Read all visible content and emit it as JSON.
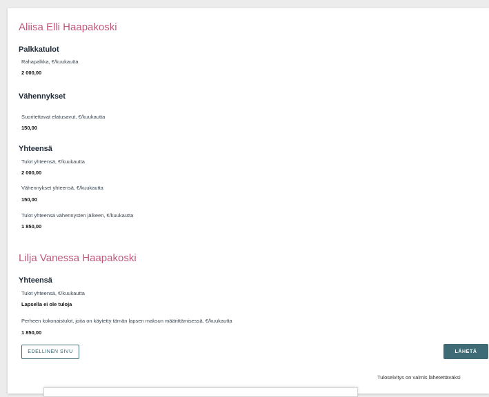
{
  "persons": [
    {
      "name": "Aliisa Elli Haapakoski",
      "salary": {
        "heading": "Palkkatulot",
        "label": "Rahapalkka, €/kuukautta",
        "value": "2 000,00"
      },
      "deductions": {
        "heading": "Vähennykset",
        "label": "Suoritettavat elatusavut, €/kuukautta",
        "value": "150,00"
      },
      "total": {
        "heading": "Yhteensä",
        "items": [
          {
            "label": "Tulot yhteensä, €/kuukautta",
            "value": "2 000,00"
          },
          {
            "label": "Vähennykset yhteensä, €/kuukautta",
            "value": "150,00"
          },
          {
            "label": "Tulot yhteensä vähennysten jälkeen, €/kuukautta",
            "value": "1 850,00"
          }
        ]
      }
    },
    {
      "name": "Lilja Vanessa Haapakoski",
      "total": {
        "heading": "Yhteensä",
        "items": [
          {
            "label": "Tulot yhteensä, €/kuukautta",
            "value": "Lapsella ei ole tuloja"
          },
          {
            "label": "Perheen kokonaistulot, joita on käytetty tämän lapsen maksun määrittämisessä, €/kuukautta",
            "value": "1 850,00"
          }
        ]
      }
    }
  ],
  "buttons": {
    "previous": "EDELLINEN SIVU",
    "send": "LÄHETÄ"
  },
  "status_text": "Tuloselvitys on valmis lähetettäväksi",
  "colors": {
    "person_name": "#c0587a",
    "primary": "#3e6b76",
    "background": "#ececec"
  }
}
